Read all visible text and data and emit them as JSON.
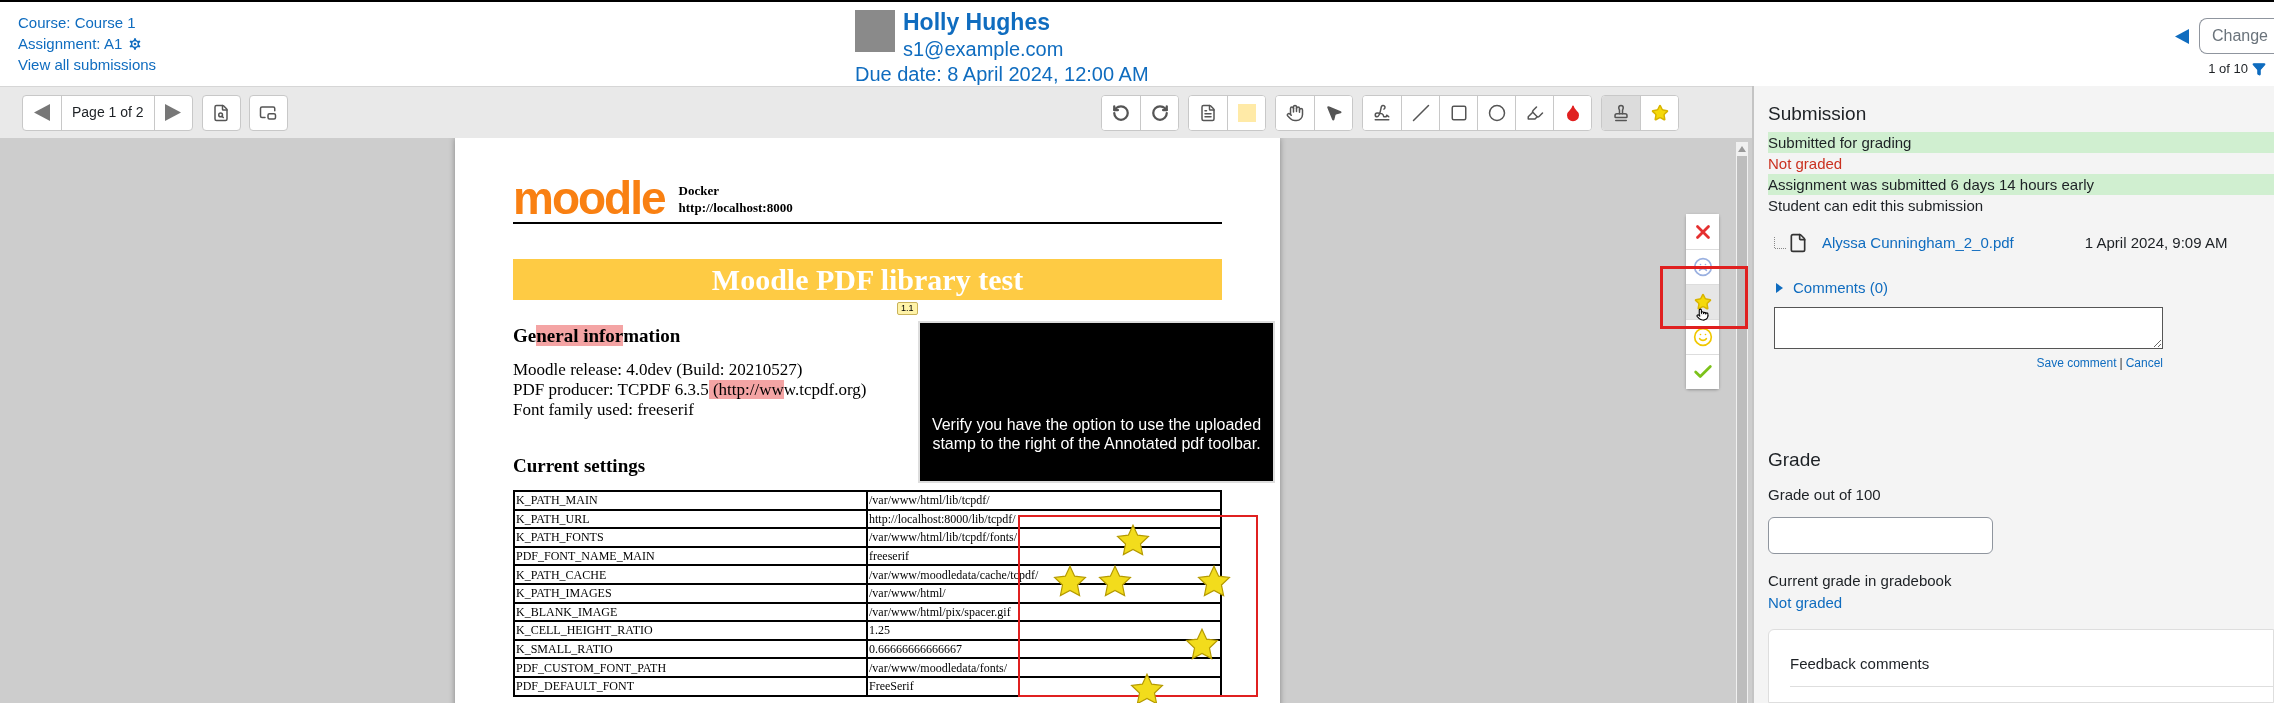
{
  "header": {
    "course_link": "Course: Course 1",
    "assignment_link": "Assignment: A1",
    "view_all_link": "View all submissions",
    "user": {
      "name": "Holly Hughes",
      "email": "s1@example.com"
    },
    "due_date": "Due date: 8 April 2024, 12:00 AM",
    "change_user_select": {
      "value": "Change"
    },
    "pager": "1 of 10"
  },
  "toolbar": {
    "page_label": "Page 1 of 2",
    "tool_groups": [
      [
        {
          "kind": "rotate-left",
          "selected": false
        },
        {
          "kind": "rotate-right",
          "selected": false
        }
      ],
      [
        {
          "kind": "comment",
          "selected": false
        },
        {
          "kind": "swatch",
          "selected": false
        }
      ],
      [
        {
          "kind": "pan",
          "selected": false
        },
        {
          "kind": "select",
          "selected": false
        }
      ],
      [
        {
          "kind": "pen",
          "selected": false
        },
        {
          "kind": "line",
          "selected": false
        },
        {
          "kind": "rectangle",
          "selected": false
        },
        {
          "kind": "oval",
          "selected": false
        },
        {
          "kind": "highlighter",
          "selected": false
        },
        {
          "kind": "color",
          "selected": false
        }
      ],
      [
        {
          "kind": "stamp",
          "selected": true
        },
        {
          "kind": "stamp-picker",
          "selected": false
        }
      ]
    ]
  },
  "stamp_menu": [
    {
      "kind": "cross",
      "selected": false
    },
    {
      "kind": "sad",
      "selected": false
    },
    {
      "kind": "star",
      "selected": true
    },
    {
      "kind": "smile",
      "selected": false
    },
    {
      "kind": "tick",
      "selected": false
    }
  ],
  "document": {
    "logo": "moodle",
    "site_name": "Docker",
    "site_url": "http://localhost:8000",
    "banner": "Moodle PDF library test",
    "comment_marker": "1.1",
    "general_heading": [
      {
        "text": "Ge",
        "highlight": false
      },
      {
        "text": "neral infor",
        "highlight": true
      },
      {
        "text": "mation",
        "highlight": false
      }
    ],
    "general_lines": [
      [
        {
          "text": "Moodle release: 4.0dev (Build: 20210527)",
          "highlight": false
        }
      ],
      [
        {
          "text": "PDF producer: TCPDF 6.3.5",
          "highlight": false
        },
        {
          "text": " (http://ww",
          "highlight": true
        },
        {
          "text": "w.tcpdf.org)",
          "highlight": false
        }
      ],
      [
        {
          "text": "Font family used: freeserif",
          "highlight": false
        }
      ]
    ],
    "settings_heading": "Current settings",
    "settings_rows": [
      [
        "K_PATH_MAIN",
        "/var/www/html/lib/tcpdf/"
      ],
      [
        "K_PATH_URL",
        "http://localhost:8000/lib/tcpdf/"
      ],
      [
        "K_PATH_FONTS",
        "/var/www/html/lib/tcpdf/fonts/"
      ],
      [
        "PDF_FONT_NAME_MAIN",
        "freeserif"
      ],
      [
        "K_PATH_CACHE",
        "/var/www/moodledata/cache/tcpdf/"
      ],
      [
        "K_PATH_IMAGES",
        "/var/www/html/"
      ],
      [
        "K_BLANK_IMAGE",
        "/var/www/html/pix/spacer.gif"
      ],
      [
        "K_CELL_HEIGHT_RATIO",
        "1.25"
      ],
      [
        "K_SMALL_RATIO",
        "0.66666666666667"
      ],
      [
        "PDF_CUSTOM_FONT_PATH",
        "/var/www/moodledata/fonts/"
      ],
      [
        "PDF_DEFAULT_FONT",
        "FreeSerif"
      ]
    ],
    "note": "Verify you have the option to use the uploaded stamp to the right of the Annotated pdf toolbar."
  },
  "submission": {
    "heading": "Submission",
    "status": [
      {
        "text": "Submitted for grading",
        "kind": "success"
      },
      {
        "text": "Not graded",
        "kind": "danger"
      },
      {
        "text": "Assignment was submitted 6 days 14 hours early",
        "kind": "success"
      },
      {
        "text": "Student can edit this submission",
        "kind": "plain"
      }
    ],
    "file": {
      "name": "Alyssa Cunningham_2_0.pdf",
      "date": "1 April 2024, 9:09 AM"
    },
    "comments_toggle": "Comments (0)",
    "save_comment": "Save comment",
    "separator": "|",
    "cancel": "Cancel"
  },
  "grade": {
    "heading": "Grade",
    "field_label": "Grade out of 100",
    "gradebook_label": "Current grade in gradebook",
    "gradebook_value": "Not graded"
  },
  "feedback": {
    "heading": "Feedback comments"
  }
}
